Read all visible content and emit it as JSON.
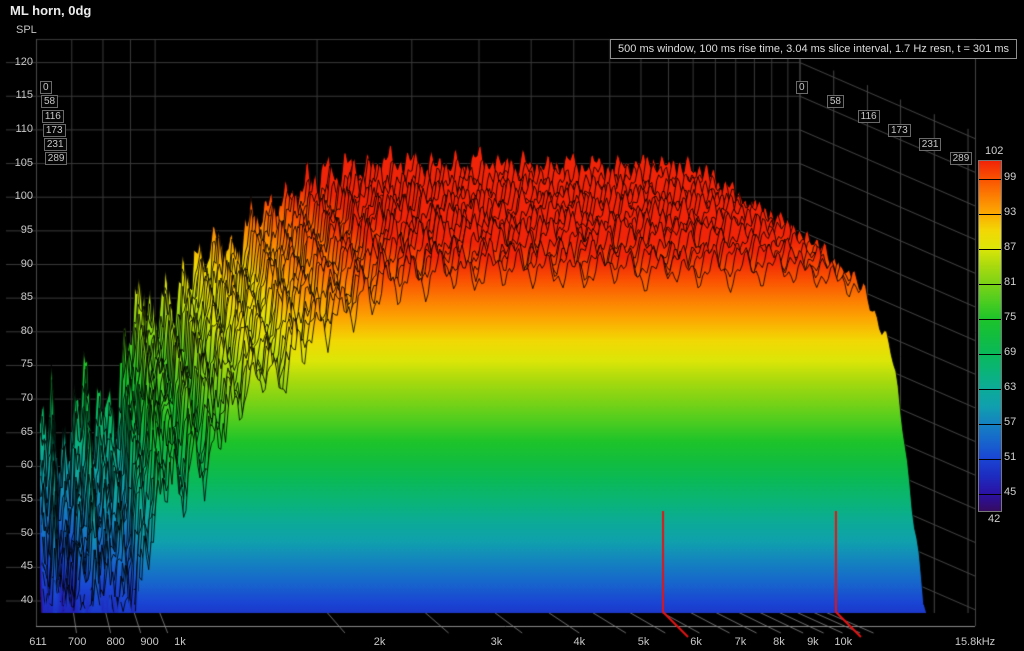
{
  "header": {
    "title": "ML horn, 0dg",
    "axis_label": "SPL",
    "info": "500 ms window, 100 ms rise time, 3.04 ms slice interval, 1.7 Hz resn, t = 301 ms"
  },
  "chart_data": {
    "type": "waterfall",
    "title": "ML horn, 0dg",
    "ylabel": "SPL",
    "xlabel": "Hz",
    "freq_range_hz": [
      611,
      15800
    ],
    "spl_axis_range_db": [
      40,
      120
    ],
    "spl_ticks": [
      120,
      115,
      110,
      105,
      100,
      95,
      90,
      85,
      80,
      75,
      70,
      65,
      60,
      55,
      50,
      45,
      40
    ],
    "x_ticks": [
      {
        "f": 611,
        "label": "611"
      },
      {
        "f": 700,
        "label": "700"
      },
      {
        "f": 800,
        "label": "800"
      },
      {
        "f": 900,
        "label": "900"
      },
      {
        "f": 1000,
        "label": "1k"
      },
      {
        "f": 2000,
        "label": "2k"
      },
      {
        "f": 3000,
        "label": "3k"
      },
      {
        "f": 4000,
        "label": "4k"
      },
      {
        "f": 5000,
        "label": "5k"
      },
      {
        "f": 6000,
        "label": "6k"
      },
      {
        "f": 7000,
        "label": "7k"
      },
      {
        "f": 8000,
        "label": "8k"
      },
      {
        "f": 9000,
        "label": "9k"
      },
      {
        "f": 10000,
        "label": "10k"
      },
      {
        "f": 15800,
        "label": "15.8kHz"
      }
    ],
    "grid_freqs_hz": [
      700,
      800,
      900,
      1000,
      2000,
      3000,
      4000,
      5000,
      6000,
      7000,
      8000,
      9000,
      10000,
      11000,
      12000,
      13000,
      14000,
      15000
    ],
    "time_total_ms": 301,
    "slice_interval_ms": 3.04,
    "time_ticks_ms": [
      0,
      58,
      116,
      173,
      231,
      289
    ],
    "colorbar": {
      "min_db": 42,
      "max_db": 102,
      "ticks": [
        102,
        99,
        93,
        87,
        81,
        75,
        69,
        63,
        57,
        51,
        45,
        42
      ],
      "stops": [
        [
          42,
          "#350b60"
        ],
        [
          45,
          "#2a12a4"
        ],
        [
          48,
          "#1d2cc0"
        ],
        [
          51,
          "#1a45d4"
        ],
        [
          54,
          "#1766cc"
        ],
        [
          57,
          "#1482c0"
        ],
        [
          60,
          "#10a0ae"
        ],
        [
          63,
          "#0cab97"
        ],
        [
          66,
          "#0ab478"
        ],
        [
          69,
          "#0ab95a"
        ],
        [
          72,
          "#12bd3e"
        ],
        [
          75,
          "#1ec42a"
        ],
        [
          78,
          "#4ecd20"
        ],
        [
          81,
          "#7cd316"
        ],
        [
          84,
          "#a8da0e"
        ],
        [
          87,
          "#dce608"
        ],
        [
          90,
          "#f2d804"
        ],
        [
          93,
          "#fcaa02"
        ],
        [
          96,
          "#fc7e02"
        ],
        [
          99,
          "#fa5102"
        ],
        [
          102,
          "#f02408"
        ]
      ]
    },
    "cursors_hz": [
      5350,
      9750
    ],
    "cursor_color": "#e51414",
    "envelope_db": [
      [
        611,
        63
      ],
      [
        640,
        70
      ],
      [
        665,
        60
      ],
      [
        700,
        66
      ],
      [
        735,
        74
      ],
      [
        770,
        65
      ],
      [
        800,
        71
      ],
      [
        840,
        66
      ],
      [
        870,
        76
      ],
      [
        910,
        82
      ],
      [
        950,
        87
      ],
      [
        990,
        80
      ],
      [
        1030,
        86
      ],
      [
        1080,
        82
      ],
      [
        1130,
        88
      ],
      [
        1200,
        90
      ],
      [
        1300,
        93
      ],
      [
        1400,
        91
      ],
      [
        1500,
        96
      ],
      [
        1650,
        98
      ],
      [
        1800,
        100
      ],
      [
        2000,
        102.5
      ],
      [
        2250,
        103.5
      ],
      [
        2500,
        104
      ],
      [
        3000,
        104.5
      ],
      [
        3500,
        104
      ],
      [
        4000,
        104.5
      ],
      [
        5000,
        104
      ],
      [
        6000,
        104
      ],
      [
        7000,
        104
      ],
      [
        8000,
        104.5
      ],
      [
        9000,
        104
      ],
      [
        10000,
        103.5
      ],
      [
        10700,
        102.5
      ],
      [
        11300,
        100
      ],
      [
        11800,
        95
      ],
      [
        12300,
        86
      ],
      [
        12800,
        72
      ],
      [
        13300,
        58
      ],
      [
        13800,
        52
      ],
      [
        14500,
        50
      ],
      [
        15800,
        47.5
      ]
    ],
    "decay_db_at_t_end": [
      [
        611,
        24
      ],
      [
        800,
        20
      ],
      [
        1000,
        13
      ],
      [
        1300,
        7
      ],
      [
        1700,
        4.5
      ],
      [
        2500,
        3.2
      ],
      [
        8000,
        3
      ],
      [
        10000,
        4
      ],
      [
        11500,
        6
      ],
      [
        13000,
        9
      ],
      [
        15800,
        10
      ]
    ],
    "background_color": "#000000",
    "grid_color": "#3a3a3a",
    "slice_line_color": "#000000"
  }
}
